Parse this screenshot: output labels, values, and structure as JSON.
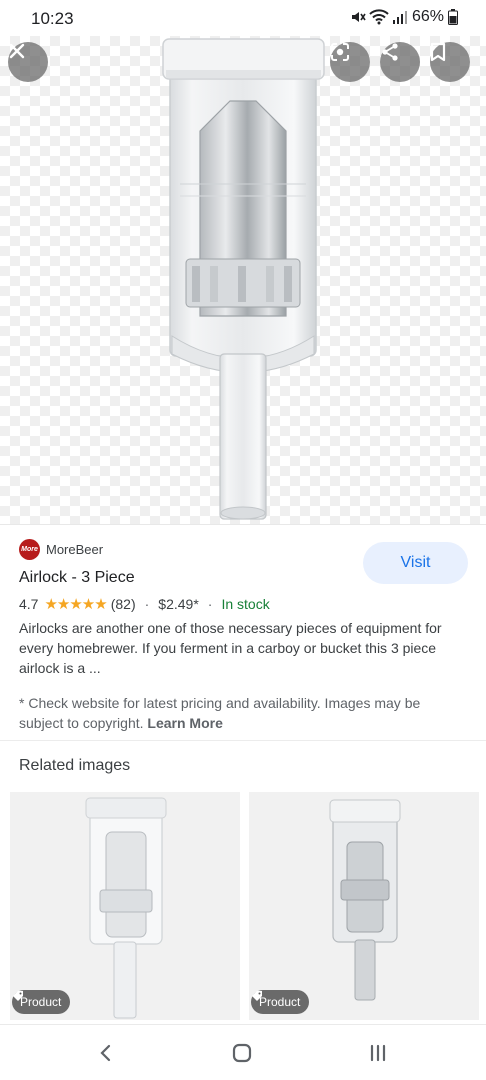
{
  "status_bar": {
    "time": "10:23",
    "battery": "66%",
    "icons": [
      "mute-icon",
      "wifi-icon",
      "signal-icon",
      "battery-icon"
    ]
  },
  "hero": {
    "actions": [
      "close-icon",
      "lens-icon",
      "share-icon",
      "bookmark-icon"
    ]
  },
  "result": {
    "source_logo_text": "More",
    "source_name": "MoreBeer",
    "visit_label": "Visit",
    "title": "Airlock - 3 Piece",
    "rating": "4.7",
    "stars": "★★★★★",
    "review_count": "(82)",
    "price": "$2.49*",
    "separator": "·",
    "availability": "In stock",
    "description": "Airlocks are another one of those necessary pieces of equipment for every homebrewer. If you ferment in a carboy or bucket this 3 piece airlock is a ...",
    "disclaimer": "* Check website for latest pricing and availability. Images may be subject to copyright.",
    "learn_more": "Learn More"
  },
  "related": {
    "title": "Related images",
    "items": [
      {
        "badge": "Product"
      },
      {
        "badge": "Product"
      }
    ]
  },
  "nav_bar": {
    "buttons": [
      "back-icon",
      "home-icon",
      "recents-icon"
    ]
  },
  "colors": {
    "accent": "#1a73e8",
    "visit_bg": "#e8f0fe",
    "star": "#f5a623",
    "in_stock": "#188038",
    "logo": "#b71c1c"
  }
}
